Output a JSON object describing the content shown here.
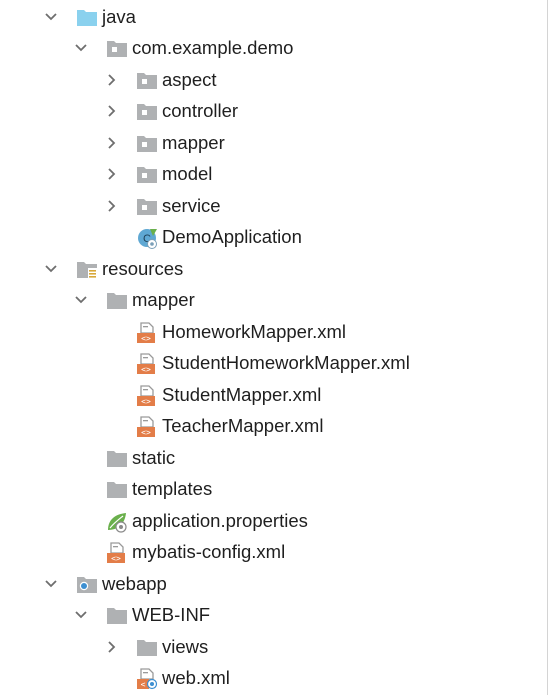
{
  "tree": {
    "nodes": [
      {
        "label": "java",
        "icon": "folder-source-icon",
        "arrow": "expanded"
      },
      {
        "label": "com.example.demo",
        "icon": "package-icon",
        "arrow": "expanded"
      },
      {
        "label": "aspect",
        "icon": "package-icon",
        "arrow": "collapsed"
      },
      {
        "label": "controller",
        "icon": "package-icon",
        "arrow": "collapsed"
      },
      {
        "label": "mapper",
        "icon": "package-icon",
        "arrow": "collapsed"
      },
      {
        "label": "model",
        "icon": "package-icon",
        "arrow": "collapsed"
      },
      {
        "label": "service",
        "icon": "package-icon",
        "arrow": "collapsed"
      },
      {
        "label": "DemoApplication",
        "icon": "spring-boot-class-icon",
        "arrow": "none"
      },
      {
        "label": "resources",
        "icon": "folder-resources-icon",
        "arrow": "expanded"
      },
      {
        "label": "mapper",
        "icon": "folder-icon",
        "arrow": "expanded"
      },
      {
        "label": "HomeworkMapper.xml",
        "icon": "xml-file-icon",
        "arrow": "none"
      },
      {
        "label": "StudentHomeworkMapper.xml",
        "icon": "xml-file-icon",
        "arrow": "none"
      },
      {
        "label": "StudentMapper.xml",
        "icon": "xml-file-icon",
        "arrow": "none"
      },
      {
        "label": "TeacherMapper.xml",
        "icon": "xml-file-icon",
        "arrow": "none"
      },
      {
        "label": "static",
        "icon": "folder-icon",
        "arrow": "none"
      },
      {
        "label": "templates",
        "icon": "folder-icon",
        "arrow": "none"
      },
      {
        "label": "application.properties",
        "icon": "spring-properties-icon",
        "arrow": "none"
      },
      {
        "label": "mybatis-config.xml",
        "icon": "xml-file-icon",
        "arrow": "none"
      },
      {
        "label": "webapp",
        "icon": "folder-web-icon",
        "arrow": "expanded"
      },
      {
        "label": "WEB-INF",
        "icon": "folder-icon",
        "arrow": "expanded"
      },
      {
        "label": "views",
        "icon": "folder-icon",
        "arrow": "collapsed"
      },
      {
        "label": "web.xml",
        "icon": "web-xml-file-icon",
        "arrow": "none"
      }
    ]
  },
  "colors": {
    "folder": "#afb1b3",
    "source_folder": "#8ad1ee",
    "xml": "#e37d48",
    "spring": "#6ab04c",
    "arrow": "#6e6e6e",
    "text": "#1f1f1f"
  }
}
